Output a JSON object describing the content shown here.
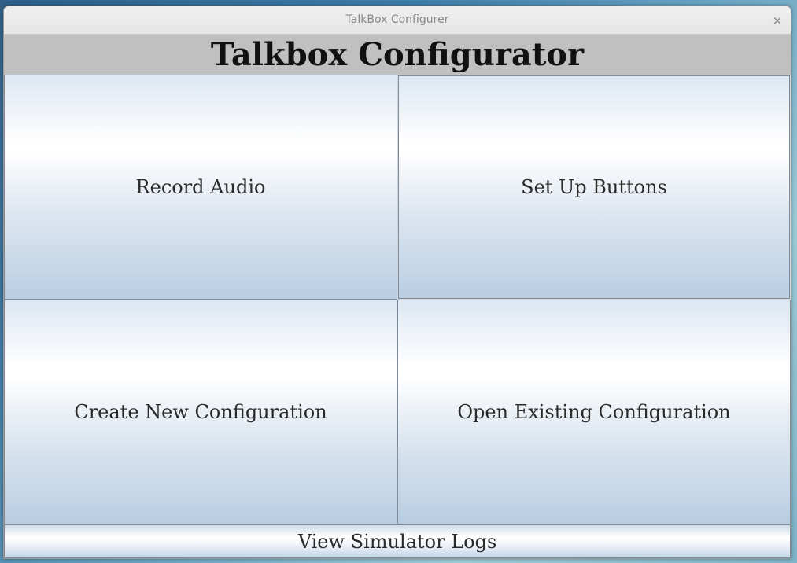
{
  "window": {
    "title": "TalkBox Configurer",
    "close_label": "×"
  },
  "header": {
    "title": "Talkbox Configurator"
  },
  "buttons": {
    "record_audio": "Record Audio",
    "set_up_buttons": "Set Up Buttons",
    "create_new_configuration": "Create New Configuration",
    "open_existing_configuration": "Open Existing Configuration",
    "view_simulator_logs": "View Simulator Logs"
  }
}
